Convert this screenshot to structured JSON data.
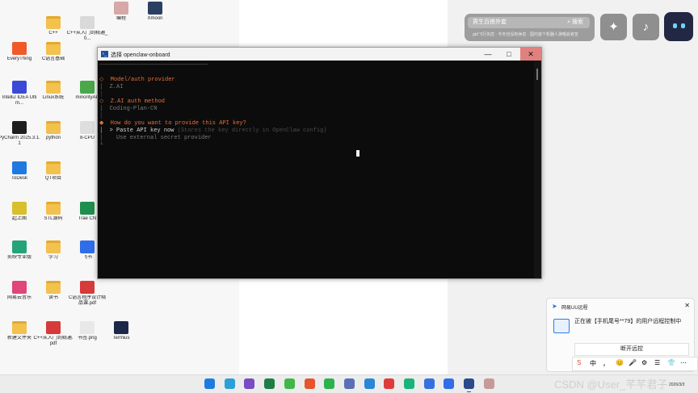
{
  "desktop": {
    "icons": [
      {
        "label": "",
        "kind": "folder",
        "color": "#f2c14e"
      },
      {
        "label": "C++",
        "kind": "folder",
        "color": "#f2c14e"
      },
      {
        "label": "C++从入门到精通_0...",
        "kind": "file",
        "color": "#d9d9d9"
      },
      {
        "label": "编程",
        "kind": "app",
        "color": "#d8a7a7"
      },
      {
        "label": "Xmoon",
        "kind": "app",
        "color": "#2c3f63"
      },
      {
        "label": "EveryThing",
        "kind": "app",
        "color": "#f05a28"
      },
      {
        "label": "C语言基础",
        "kind": "folder",
        "color": "#f2c14e"
      },
      {
        "label": "IntelliJ IDEA Ultim...",
        "kind": "app",
        "color": "#3b4ad6"
      },
      {
        "label": "Linux系统",
        "kind": "folder",
        "color": "#f2c14e"
      },
      {
        "label": "minorityAP",
        "kind": "app",
        "color": "#4aa74a"
      },
      {
        "label": "PyCharm 2025.3.1.1",
        "kind": "app",
        "color": "#1e1e1e"
      },
      {
        "label": "python",
        "kind": "folder",
        "color": "#f2c14e"
      },
      {
        "label": "8-CPU",
        "kind": "file",
        "color": "#dedede"
      },
      {
        "label": "ToDesk",
        "kind": "app",
        "color": "#1f7ae0"
      },
      {
        "label": "QT项目",
        "kind": "folder",
        "color": "#f2c14e"
      },
      {
        "label": "起上图",
        "kind": "app",
        "color": "#d7c02b"
      },
      {
        "label": "STL源码",
        "kind": "folder",
        "color": "#f2c14e"
      },
      {
        "label": "Trae CN",
        "kind": "app",
        "color": "#1e8f4e"
      },
      {
        "label": "剪映专业版",
        "kind": "app",
        "color": "#27a37a"
      },
      {
        "label": "学习",
        "kind": "folder",
        "color": "#f2c14e"
      },
      {
        "label": "飞书",
        "kind": "app",
        "color": "#2f6ee8"
      },
      {
        "label": "网易云音乐",
        "kind": "app",
        "color": "#e0457b"
      },
      {
        "label": "读书",
        "kind": "folder",
        "color": "#f2c14e"
      },
      {
        "label": "C语言程序设计精品课.pdf",
        "kind": "file",
        "color": "#d63a3a"
      },
      {
        "label": "新建文件夹",
        "kind": "folder",
        "color": "#f2c14e"
      },
      {
        "label": "C++从入门到精通.pdf",
        "kind": "file",
        "color": "#d63a3a"
      },
      {
        "label": "书签.png",
        "kind": "file",
        "color": "#e8e8e8"
      },
      {
        "label": "Termius",
        "kind": "app",
        "color": "#1c2847"
      }
    ]
  },
  "search_widget": {
    "query": "男生百搭外套",
    "search_label": "搜索",
    "hints": "gtd飞行失控 · 今天也没有休息 · 国内首个机器人演唱会官宣"
  },
  "window": {
    "title": "选择 openclaw-onboard",
    "minimize": "—",
    "maximize": "□",
    "close": "✕",
    "lines": [
      {
        "text": "────────────────────────────────",
        "color": "#6b6b6b"
      },
      {
        "text": "",
        "color": "#6b6b6b"
      },
      {
        "text": "◇  Model/auth provider",
        "color": "#e6713c"
      },
      {
        "text": "│  Z.AI",
        "color": "#7a7a7a"
      },
      {
        "text": "│",
        "color": "#555555"
      },
      {
        "text": "◇  Z.AI auth method",
        "color": "#e6713c"
      },
      {
        "text": "│  Coding-Plan-CN",
        "color": "#7a7a7a"
      },
      {
        "text": "│",
        "color": "#555555"
      },
      {
        "text": "◆  How do you want to provide this API key?",
        "color": "#e6713c"
      },
      {
        "text": "│  > Paste API key now",
        "color": "#d8d8d8"
      },
      {
        "text": "│    Use external secret provider",
        "color": "#7a7a7a"
      },
      {
        "text": "└",
        "color": "#3a8ae6"
      }
    ],
    "paste_hint": "(Stores the key directly in OpenClaw config)"
  },
  "notification": {
    "app": "网易UU远程",
    "message": "正在被【手机尾号**79】的用户远程控制中",
    "button": "断开远控",
    "close": "✕"
  },
  "ime": {
    "items": [
      "S",
      "中",
      "，",
      "😊",
      "🎤",
      "⚙",
      "☰",
      "👕",
      "⋯"
    ]
  },
  "taskbar": {
    "icons": [
      {
        "name": "windows-start-icon",
        "color": "#1f7ae0"
      },
      {
        "name": "edge-browser-icon",
        "color": "#2aa0d8"
      },
      {
        "name": "visual-studio-icon",
        "color": "#7b4bc4"
      },
      {
        "name": "spreadsheet-icon",
        "color": "#1e7e45"
      },
      {
        "name": "qt-creator-icon",
        "color": "#41b649"
      },
      {
        "name": "csdn-icon",
        "color": "#e8542d"
      },
      {
        "name": "wechat-icon",
        "color": "#2bb24c"
      },
      {
        "name": "photos-icon",
        "color": "#5a6fb8"
      },
      {
        "name": "image-viewer-icon",
        "color": "#2a86d8"
      },
      {
        "name": "wps-icon",
        "color": "#e03b3b"
      },
      {
        "name": "trae-icon",
        "color": "#1ab37a"
      },
      {
        "name": "notes-icon",
        "color": "#3470e0"
      },
      {
        "name": "feishu-icon",
        "color": "#2f6ee8"
      },
      {
        "name": "terminal-icon",
        "color": "#2b4a8b"
      },
      {
        "name": "avatar-app-icon",
        "color": "#c79a9a"
      }
    ],
    "watermark": "CSDN @User_芊芊君子",
    "date": "2026/3/3"
  }
}
